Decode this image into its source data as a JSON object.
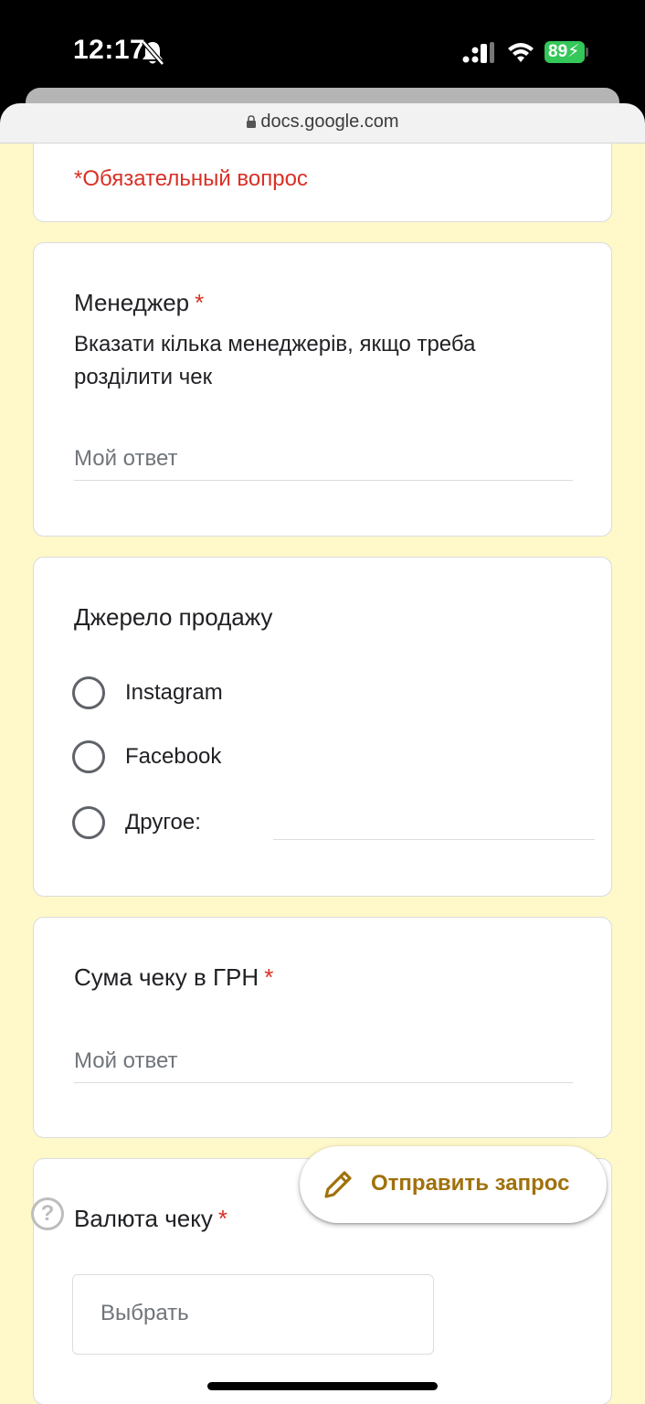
{
  "status_bar": {
    "time": "12:17",
    "battery": "89",
    "icons": [
      "bell-slash-icon",
      "cellular-signal-icon",
      "wifi-icon",
      "battery-charging-icon"
    ]
  },
  "browser": {
    "url": "docs.google.com",
    "icons": [
      "lock-icon"
    ]
  },
  "form": {
    "required_note": "*Обязательный вопрос",
    "questions": [
      {
        "title": "Менеджер",
        "required_marker": "*",
        "description": "Вказати кілька менеджерів, якщо треба розділити чек",
        "placeholder": "Мой ответ"
      },
      {
        "title": "Джерело продажу",
        "options": [
          "Instagram",
          "Facebook",
          "Другое:"
        ]
      },
      {
        "title": "Сума чеку в ГРН",
        "required_marker": "*",
        "placeholder": "Мой ответ"
      },
      {
        "title": "Валюта чеку",
        "required_marker": "*",
        "select_placeholder": "Выбрать"
      }
    ]
  },
  "help": {
    "label": "?"
  },
  "fab": {
    "label": "Отправить запрос",
    "icon": "pencil-icon",
    "color": "#a0710c"
  },
  "colors": {
    "page_background": "#fff8c9",
    "required": "#d93025",
    "battery": "#34c759"
  }
}
